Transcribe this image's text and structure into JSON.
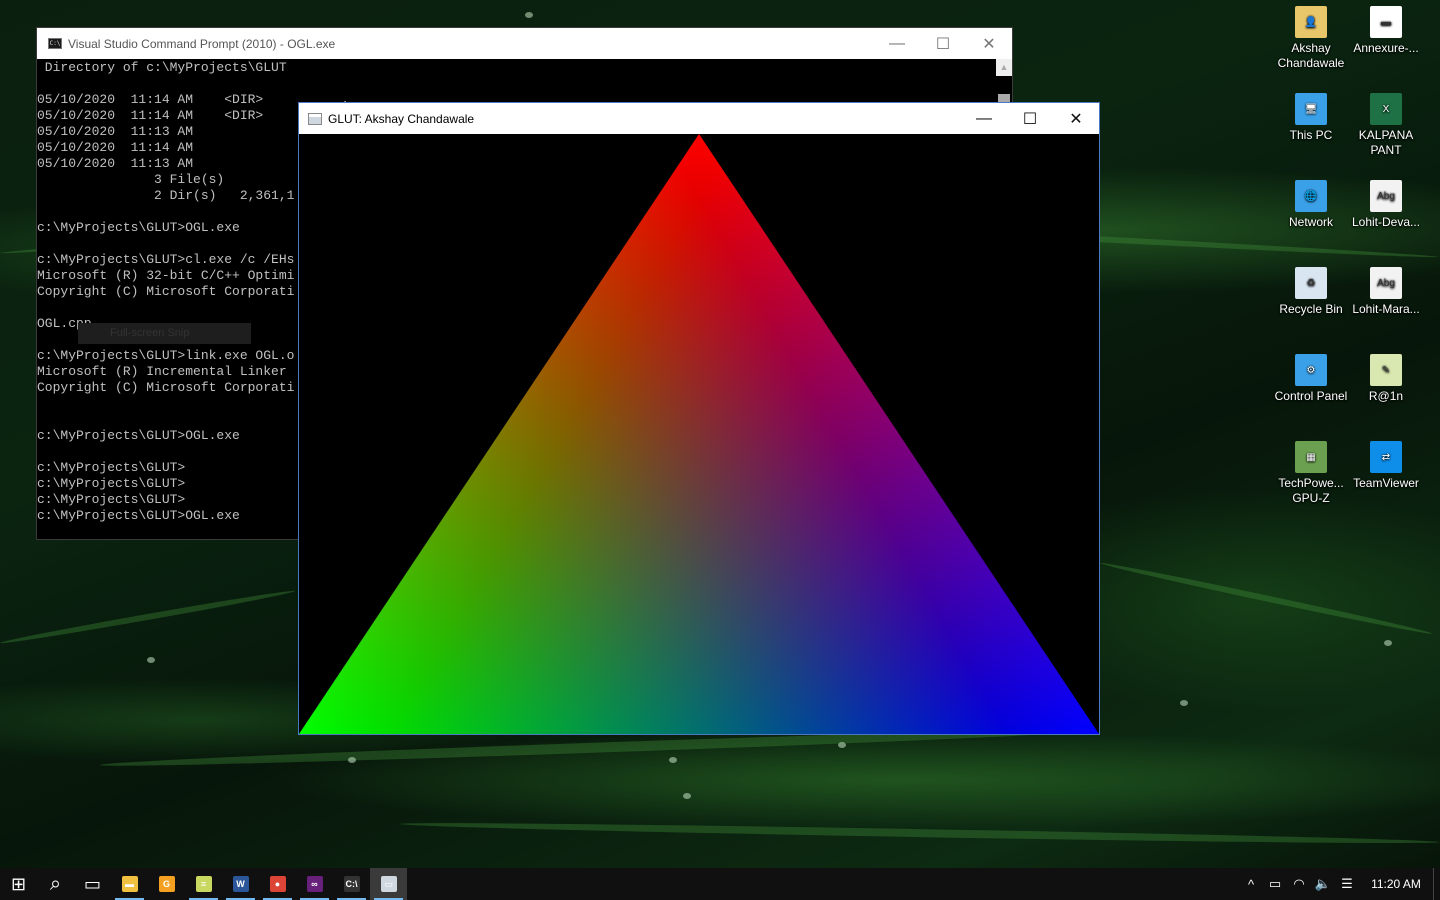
{
  "cmd_window": {
    "title": "Visual Studio Command Prompt (2010) - OGL.exe",
    "icon_text": "C:\\",
    "lines": [
      " Directory of c:\\MyProjects\\GLUT",
      "",
      "05/10/2020  11:14 AM    <DIR>          .",
      "05/10/2020  11:14 AM    <DIR>          ..",
      "05/10/2020  11:13 AM",
      "05/10/2020  11:14 AM               5",
      "05/10/2020  11:13 AM",
      "               3 File(s)",
      "               2 Dir(s)   2,361,1",
      "",
      "c:\\MyProjects\\GLUT>OGL.exe",
      "",
      "c:\\MyProjects\\GLUT>cl.exe /c /EHs",
      "Microsoft (R) 32-bit C/C++ Optimi",
      "Copyright (C) Microsoft Corporati",
      "",
      "OGL.cpp",
      "",
      "c:\\MyProjects\\GLUT>link.exe OGL.o",
      "Microsoft (R) Incremental Linker",
      "Copyright (C) Microsoft Corporati",
      "",
      "",
      "c:\\MyProjects\\GLUT>OGL.exe",
      "",
      "c:\\MyProjects\\GLUT>",
      "c:\\MyProjects\\GLUT>",
      "c:\\MyProjects\\GLUT>",
      "c:\\MyProjects\\GLUT>OGL.exe"
    ],
    "snip_tooltip": "Full-screen Snip",
    "controls": {
      "minimize": "—",
      "maximize": "☐",
      "close": "✕"
    }
  },
  "glut_window": {
    "title": "GLUT: Akshay Chandawale",
    "controls": {
      "minimize": "—",
      "maximize": "☐",
      "close": "✕"
    },
    "triangle_colors": {
      "top": "#ff0000",
      "bottom_left": "#00ff00",
      "bottom_right": "#0000ff"
    }
  },
  "desktop_icons": [
    {
      "label": "Akshay Chandawale",
      "glyph": "👤",
      "color": "#e8c66a"
    },
    {
      "label": "Annexure-...",
      "glyph": "▬",
      "color": "#ffffff"
    },
    {
      "label": "This PC",
      "glyph": "🖥",
      "color": "#3aa0e8"
    },
    {
      "label": "KALPANA PANT",
      "glyph": "X",
      "color": "#1e7145"
    },
    {
      "label": "Network",
      "glyph": "🌐",
      "color": "#3aa0e8"
    },
    {
      "label": "Lohit-Deva...",
      "glyph": "Abg",
      "color": "#f2f2f2"
    },
    {
      "label": "Recycle Bin",
      "glyph": "♻",
      "color": "#d9e6f2"
    },
    {
      "label": "Lohit-Mara...",
      "glyph": "Abg",
      "color": "#f2f2f2"
    },
    {
      "label": "Control Panel",
      "glyph": "⚙",
      "color": "#3aa0e8"
    },
    {
      "label": "R@1n",
      "glyph": "✎",
      "color": "#d8e8b0"
    },
    {
      "label": "TechPowe... GPU-Z",
      "glyph": "▦",
      "color": "#6aa050"
    },
    {
      "label": "TeamViewer",
      "glyph": "⇄",
      "color": "#0e8ee9"
    }
  ],
  "taskbar": {
    "start_glyph": "⊞",
    "search_glyph": "⌕",
    "taskview_glyph": "▭",
    "apps": [
      {
        "name": "file-explorer",
        "glyph": "▬",
        "color": "#f0c040",
        "running": true
      },
      {
        "name": "google-slides",
        "glyph": "G",
        "color": "#f4a020",
        "running": false
      },
      {
        "name": "notepad",
        "glyph": "≡",
        "color": "#c8d860",
        "running": true
      },
      {
        "name": "word",
        "glyph": "W",
        "color": "#2b579a",
        "running": true
      },
      {
        "name": "chrome",
        "glyph": "●",
        "color": "#db4437",
        "running": true
      },
      {
        "name": "visual-studio",
        "glyph": "∞",
        "color": "#68217a",
        "running": true
      },
      {
        "name": "command-prompt",
        "glyph": "C:\\",
        "color": "#333333",
        "running": true
      },
      {
        "name": "glut-app",
        "glyph": "▭",
        "color": "#cfd8e0",
        "running": true,
        "active": true
      }
    ],
    "tray": {
      "chevron": "^",
      "battery": "▭",
      "wifi": "◠",
      "volume": "🔈",
      "notifications": "☰",
      "time": "11:20 AM"
    }
  }
}
